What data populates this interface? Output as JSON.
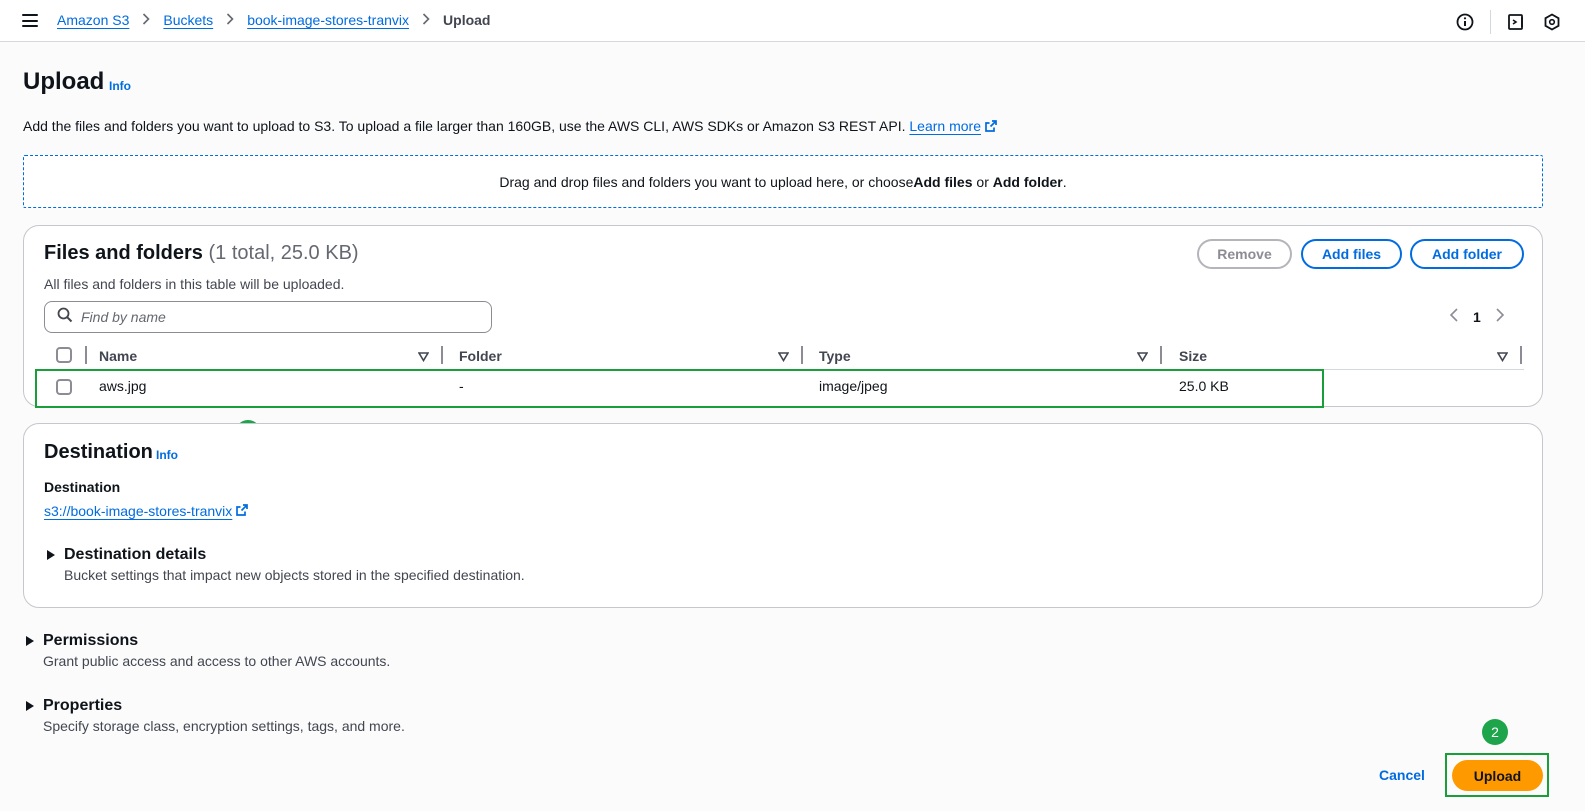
{
  "breadcrumb": {
    "items": [
      "Amazon S3",
      "Buckets",
      "book-image-stores-tranvix"
    ],
    "current": "Upload"
  },
  "page": {
    "title": "Upload",
    "info": "Info",
    "description": "Add the files and folders you want to upload to S3. To upload a file larger than 160GB, use the AWS CLI, AWS SDKs or Amazon S3 REST API.",
    "learn_more": "Learn more"
  },
  "dropzone": {
    "text_before": "Drag and drop files and folders you want to upload here, or choose ",
    "add_files": "Add files",
    "or": " or ",
    "add_folder": "Add folder",
    "period": "."
  },
  "files": {
    "title": "Files and folders",
    "count": "(1 total, 25.0 KB)",
    "subtitle": "All files and folders in this table will be uploaded.",
    "remove": "Remove",
    "add_files": "Add files",
    "add_folder": "Add folder",
    "search_placeholder": "Find by name",
    "page": "1",
    "columns": [
      "Name",
      "Folder",
      "Type",
      "Size"
    ],
    "rows": [
      {
        "name": "aws.jpg",
        "folder": "-",
        "type": "image/jpeg",
        "size": "25.0 KB"
      }
    ]
  },
  "destination": {
    "title": "Destination",
    "info": "Info",
    "label": "Destination",
    "link": "s3://book-image-stores-tranvix",
    "details_title": "Destination details",
    "details_desc": "Bucket settings that impact new objects stored in the specified destination."
  },
  "permissions": {
    "title": "Permissions",
    "desc": "Grant public access and access to other AWS accounts."
  },
  "properties": {
    "title": "Properties",
    "desc": "Specify storage class, encryption settings, tags, and more."
  },
  "footer": {
    "cancel": "Cancel",
    "upload": "Upload"
  },
  "annotations": {
    "badge1": "1",
    "badge2": "2"
  },
  "colors": {
    "link": "#006ce0",
    "primary_button": "#ff9900",
    "highlight": "#1a9e3a"
  }
}
